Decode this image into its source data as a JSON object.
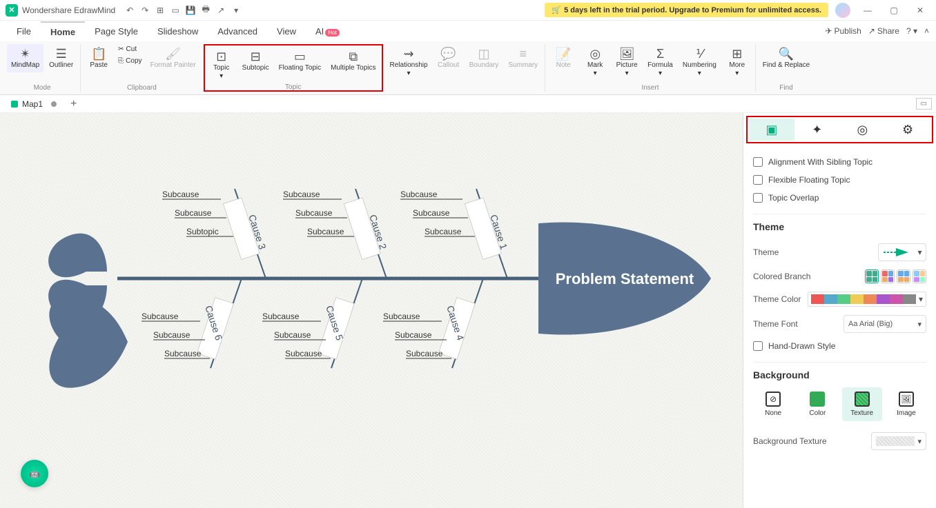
{
  "app": {
    "title": "Wondershare EdrawMind"
  },
  "trial": {
    "icon": "🛒",
    "text": "5 days left in the trial period. Upgrade to Premium for unlimited access."
  },
  "menu": {
    "items": [
      "File",
      "Home",
      "Page Style",
      "Slideshow",
      "Advanced",
      "View",
      "AI"
    ],
    "activeIndex": 1,
    "hotBadge": "Hot",
    "publish": "Publish",
    "share": "Share"
  },
  "ribbon": {
    "mode": {
      "mindmap": "MindMap",
      "outliner": "Outliner",
      "label": "Mode"
    },
    "clipboard": {
      "paste": "Paste",
      "cut": "Cut",
      "copy": "Copy",
      "format": "Format Painter",
      "label": "Clipboard"
    },
    "topic": {
      "topic": "Topic",
      "subtopic": "Subtopic",
      "floating": "Floating Topic",
      "multiple": "Multiple Topics",
      "label": "Topic"
    },
    "other": {
      "relationship": "Relationship",
      "callout": "Callout",
      "boundary": "Boundary",
      "summary": "Summary"
    },
    "insert": {
      "note": "Note",
      "mark": "Mark",
      "picture": "Picture",
      "formula": "Formula",
      "numbering": "Numbering",
      "more": "More",
      "label": "Insert"
    },
    "find": {
      "find": "Find & Replace",
      "label": "Find"
    }
  },
  "tabs": {
    "doc": "Map1"
  },
  "diagram": {
    "problem": "Problem Statement",
    "causesTop": [
      "Cause 1",
      "Cause 2",
      "Cause 3"
    ],
    "causesBottom": [
      "Cause 4",
      "Cause 5",
      "Cause 6"
    ],
    "sub": "Subcause",
    "subtopic": "Subtopic"
  },
  "panel": {
    "align": "Alignment With Sibling Topic",
    "flex": "Flexible Floating Topic",
    "overlap": "Topic Overlap",
    "theme": "Theme",
    "themeLabel": "Theme",
    "colored": "Colored Branch",
    "themeColor": "Theme Color",
    "themeFont": "Theme Font",
    "font": "Arial (Big)",
    "hand": "Hand-Drawn Style",
    "bg": "Background",
    "bgNone": "None",
    "bgColor": "Color",
    "bgTexture": "Texture",
    "bgImage": "Image",
    "bgTex": "Background Texture"
  }
}
